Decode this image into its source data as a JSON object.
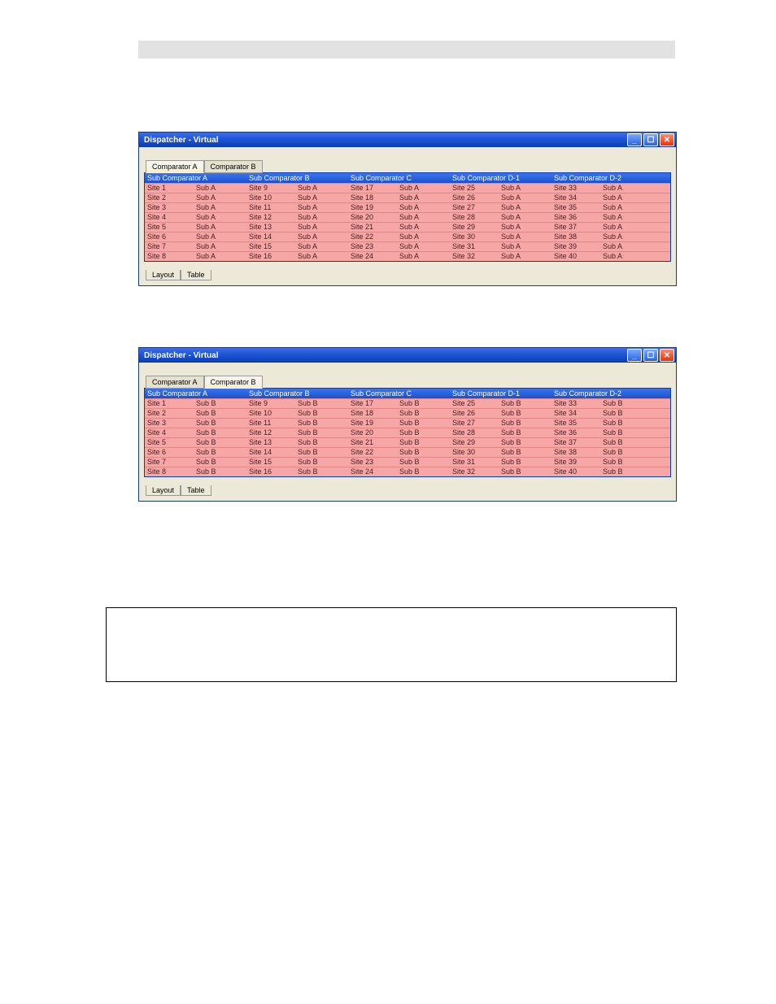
{
  "window_title": "Dispatcher - Virtual",
  "tabs": {
    "a": "Comparator A",
    "b": "Comparator B"
  },
  "bottom_tabs": {
    "layout": "Layout",
    "table": "Table"
  },
  "headers": {
    "c0": "Sub Comparator A",
    "c1": "Sub Comparator B",
    "c2": "Sub Comparator C",
    "c3": "Sub Comparator D-1",
    "c4": "Sub Comparator D-2"
  },
  "win1": {
    "sub": "Sub A",
    "rows": [
      {
        "s0": "Site 1",
        "s1": "Site 9",
        "s2": "Site 17",
        "s3": "Site 25",
        "s4": "Site 33"
      },
      {
        "s0": "Site 2",
        "s1": "Site 10",
        "s2": "Site 18",
        "s3": "Site 26",
        "s4": "Site 34"
      },
      {
        "s0": "Site 3",
        "s1": "Site 11",
        "s2": "Site 19",
        "s3": "Site 27",
        "s4": "Site 35"
      },
      {
        "s0": "Site 4",
        "s1": "Site 12",
        "s2": "Site 20",
        "s3": "Site 28",
        "s4": "Site 36"
      },
      {
        "s0": "Site 5",
        "s1": "Site 13",
        "s2": "Site 21",
        "s3": "Site 29",
        "s4": "Site 37"
      },
      {
        "s0": "Site 6",
        "s1": "Site 14",
        "s2": "Site 22",
        "s3": "Site 30",
        "s4": "Site 38"
      },
      {
        "s0": "Site 7",
        "s1": "Site 15",
        "s2": "Site 23",
        "s3": "Site 31",
        "s4": "Site 39"
      },
      {
        "s0": "Site 8",
        "s1": "Site 16",
        "s2": "Site 24",
        "s3": "Site 32",
        "s4": "Site 40"
      }
    ]
  },
  "win2": {
    "sub": "Sub B",
    "rows": [
      {
        "s0": "Site 1",
        "s1": "Site 9",
        "s2": "Site 17",
        "s3": "Site 25",
        "s4": "Site 33"
      },
      {
        "s0": "Site 2",
        "s1": "Site 10",
        "s2": "Site 18",
        "s3": "Site 26",
        "s4": "Site 34"
      },
      {
        "s0": "Site 3",
        "s1": "Site 11",
        "s2": "Site 19",
        "s3": "Site 27",
        "s4": "Site 35"
      },
      {
        "s0": "Site 4",
        "s1": "Site 12",
        "s2": "Site 20",
        "s3": "Site 28",
        "s4": "Site 36"
      },
      {
        "s0": "Site 5",
        "s1": "Site 13",
        "s2": "Site 21",
        "s3": "Site 29",
        "s4": "Site 37"
      },
      {
        "s0": "Site 6",
        "s1": "Site 14",
        "s2": "Site 22",
        "s3": "Site 30",
        "s4": "Site 38"
      },
      {
        "s0": "Site 7",
        "s1": "Site 15",
        "s2": "Site 23",
        "s3": "Site 31",
        "s4": "Site 39"
      },
      {
        "s0": "Site 8",
        "s1": "Site 16",
        "s2": "Site 24",
        "s3": "Site 32",
        "s4": "Site 40"
      }
    ]
  }
}
